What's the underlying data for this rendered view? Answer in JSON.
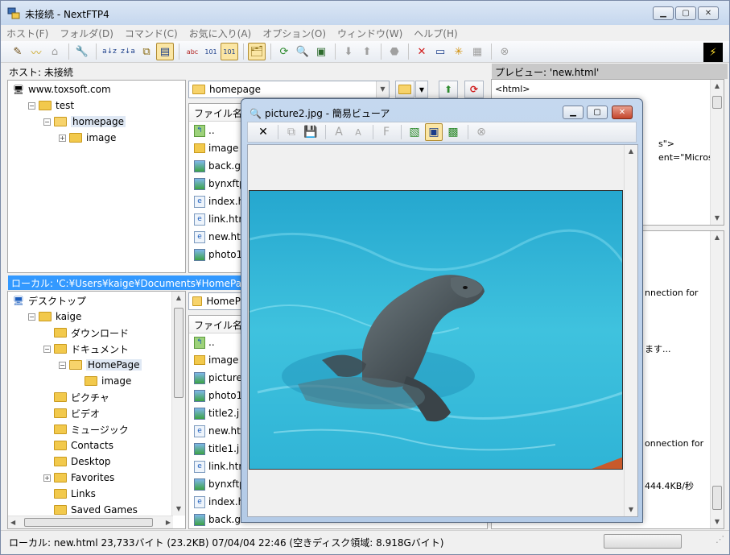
{
  "window": {
    "title": "未接続 - NextFTP4"
  },
  "menu": [
    "ホスト(F)",
    "フォルダ(D)",
    "コマンド(C)",
    "お気に入り(A)",
    "オプション(O)",
    "ウィンドウ(W)",
    "ヘルプ(H)"
  ],
  "host_label": "ホスト: 未接続",
  "preview_label": "プレビュー: 'new.html'",
  "host_tree": [
    {
      "label": "www.toxsoft.com",
      "level": 0,
      "icon": "server"
    },
    {
      "label": "test",
      "level": 1,
      "icon": "folder",
      "expander": "−"
    },
    {
      "label": "homepage",
      "level": 2,
      "icon": "folder-open",
      "expander": "−",
      "selected": true
    },
    {
      "label": "image",
      "level": 3,
      "icon": "folder",
      "expander": "+"
    }
  ],
  "remote_path": "homepage",
  "remote_list": {
    "header": "ファイル名",
    "files": [
      {
        "name": "..",
        "type": "up"
      },
      {
        "name": "image",
        "type": "folder"
      },
      {
        "name": "back.gi",
        "type": "img"
      },
      {
        "name": "bynxftp",
        "type": "img"
      },
      {
        "name": "index.h",
        "type": "html"
      },
      {
        "name": "link.htr",
        "type": "html"
      },
      {
        "name": "new.ht",
        "type": "html"
      },
      {
        "name": "photo1",
        "type": "img"
      }
    ]
  },
  "local_label": "ローカル: 'C:¥Users¥kaige¥Documents¥HomePage'",
  "local_tree": [
    {
      "label": "デスクトップ",
      "level": 0,
      "icon": "desktop"
    },
    {
      "label": "kaige",
      "level": 1,
      "icon": "folder",
      "expander": "−"
    },
    {
      "label": "ダウンロード",
      "level": 2,
      "icon": "folder"
    },
    {
      "label": "ドキュメント",
      "level": 2,
      "icon": "folder",
      "expander": "−"
    },
    {
      "label": "HomePage",
      "level": 3,
      "icon": "folder-open",
      "expander": "−",
      "selected": true
    },
    {
      "label": "image",
      "level": 4,
      "icon": "folder"
    },
    {
      "label": "ピクチャ",
      "level": 2,
      "icon": "folder"
    },
    {
      "label": "ビデオ",
      "level": 2,
      "icon": "folder"
    },
    {
      "label": "ミュージック",
      "level": 2,
      "icon": "folder"
    },
    {
      "label": "Contacts",
      "level": 2,
      "icon": "folder"
    },
    {
      "label": "Desktop",
      "level": 2,
      "icon": "folder"
    },
    {
      "label": "Favorites",
      "level": 2,
      "icon": "folder",
      "expander": "+"
    },
    {
      "label": "Links",
      "level": 2,
      "icon": "folder"
    },
    {
      "label": "Saved Games",
      "level": 2,
      "icon": "folder"
    }
  ],
  "local_path": "HomeP",
  "local_list": {
    "header": "ファイル名",
    "files": [
      {
        "name": "..",
        "type": "up"
      },
      {
        "name": "image",
        "type": "folder"
      },
      {
        "name": "picture",
        "type": "img"
      },
      {
        "name": "photo1",
        "type": "img"
      },
      {
        "name": "title2.j",
        "type": "img"
      },
      {
        "name": "new.ht",
        "type": "html"
      },
      {
        "name": "title1.j",
        "type": "img"
      },
      {
        "name": "link.htr",
        "type": "html"
      },
      {
        "name": "bynxftp",
        "type": "img"
      },
      {
        "name": "index.h",
        "type": "html"
      },
      {
        "name": "back.gi",
        "type": "img"
      }
    ]
  },
  "preview_lines": {
    "top": [
      "<html>",
      "s\">",
      "ent=\"Microsoft"
    ],
    "bottom": [
      "nnection for",
      "ます...",
      "onnection for",
      "444.4KB/秒"
    ]
  },
  "status": "ローカル: new.html  23,733バイト (23.2KB)  07/04/04 22:46  (空きディスク領域: 8.918Gバイト)",
  "viewer": {
    "title": "picture2.jpg - 簡易ビューア",
    "colors": {
      "water_light": "#43c4e0",
      "water_dark": "#1589b4"
    }
  }
}
